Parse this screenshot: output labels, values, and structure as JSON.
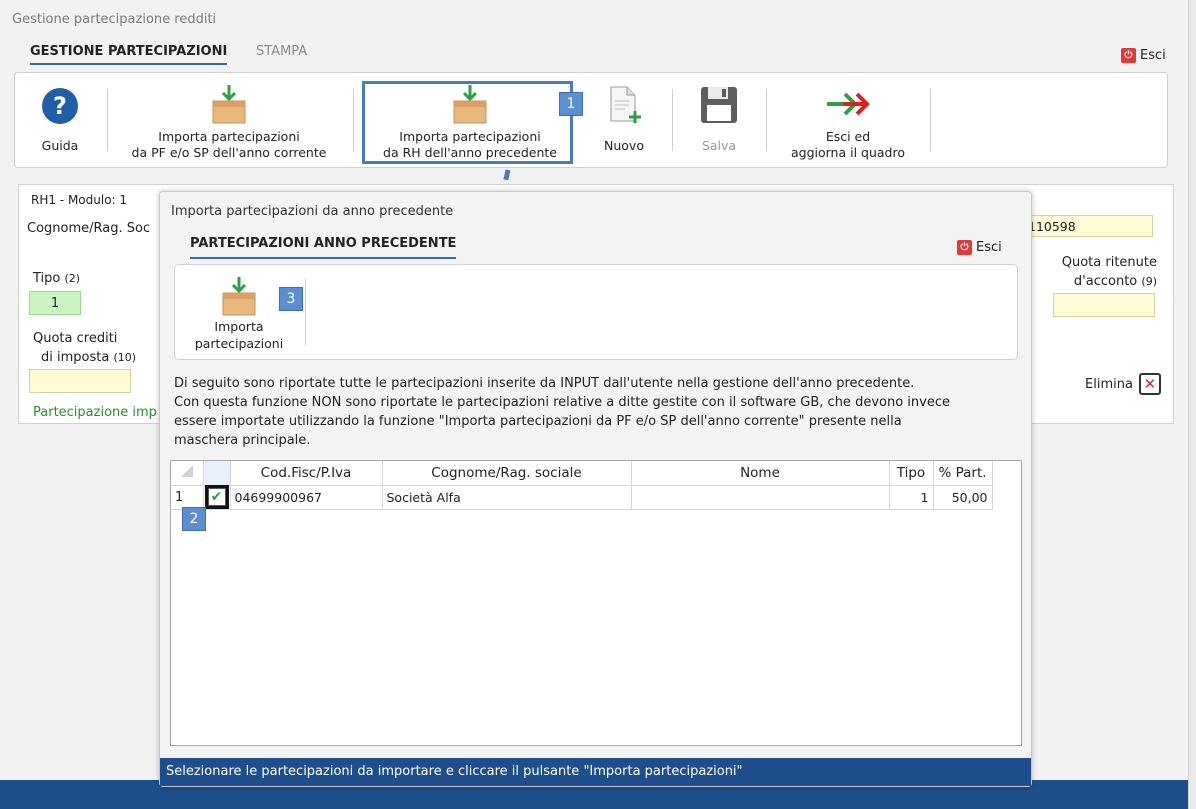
{
  "window": {
    "title": "Gestione partecipazione redditi"
  },
  "tabs": [
    {
      "label": "GESTIONE PARTECIPAZIONI"
    },
    {
      "label": "STAMPA"
    }
  ],
  "esci_label": "Esci",
  "toolbar": {
    "guida": "Guida",
    "import_pf_line1": "Importa partecipazioni",
    "import_pf_line2": "da PF e/o SP dell'anno corrente",
    "import_rh_line1": "Importa partecipazioni",
    "import_rh_line2": "da RH dell'anno precedente",
    "nuovo": "Nuovo",
    "salva": "Salva",
    "esci_agg_line1": "Esci ed",
    "esci_agg_line2": "aggiorna il quadro"
  },
  "badges": {
    "b1": "1",
    "b2": "2",
    "b3": "3"
  },
  "panel": {
    "legend": "RH1 - Modulo: 1",
    "cognome_label": "Cognome/Rag. Soc",
    "cf_value": "110598",
    "tipo_label": "Tipo",
    "tipo_num": "(2)",
    "tipo_value": "1",
    "quota_ritenute_line1": "Quota ritenute",
    "quota_ritenute_line2": "d'acconto",
    "quota_ritenute_num": "(9)",
    "quota_crediti_line1": "Quota crediti",
    "quota_crediti_line2": "di imposta",
    "quota_crediti_num": "(10)",
    "partecipazione": "Partecipazione imp",
    "elimina": "Elimina"
  },
  "dialog": {
    "title": "Importa partecipazioni da anno precedente",
    "tab": "PARTECIPAZIONI ANNO PRECEDENTE",
    "esci": "Esci",
    "import_btn_line1": "Importa",
    "import_btn_line2": "partecipazioni",
    "info_lines": [
      "Di seguito sono riportate tutte le partecipazioni inserite da INPUT dall'utente nella gestione dell'anno precedente.",
      "Con questa funzione NON sono riportate le partecipazioni relative a ditte gestite con il software GB, che devono invece",
      "essere importate utilizzando la funzione \"Importa partecipazioni da PF e/o SP dell'anno corrente\" presente nella",
      "maschera principale."
    ],
    "grid": {
      "columns": [
        "Cod.Fisc/P.Iva",
        "Cognome/Rag. sociale",
        "Nome",
        "Tipo",
        "% Part."
      ],
      "rows": [
        {
          "num": "1",
          "cf": "04699900967",
          "name": "Società Alfa",
          "nome": "",
          "tipo": "1",
          "perc": "50,00"
        }
      ]
    },
    "status": "Selezionare le partecipazioni da importare e cliccare il pulsante \"Importa partecipazioni\""
  }
}
